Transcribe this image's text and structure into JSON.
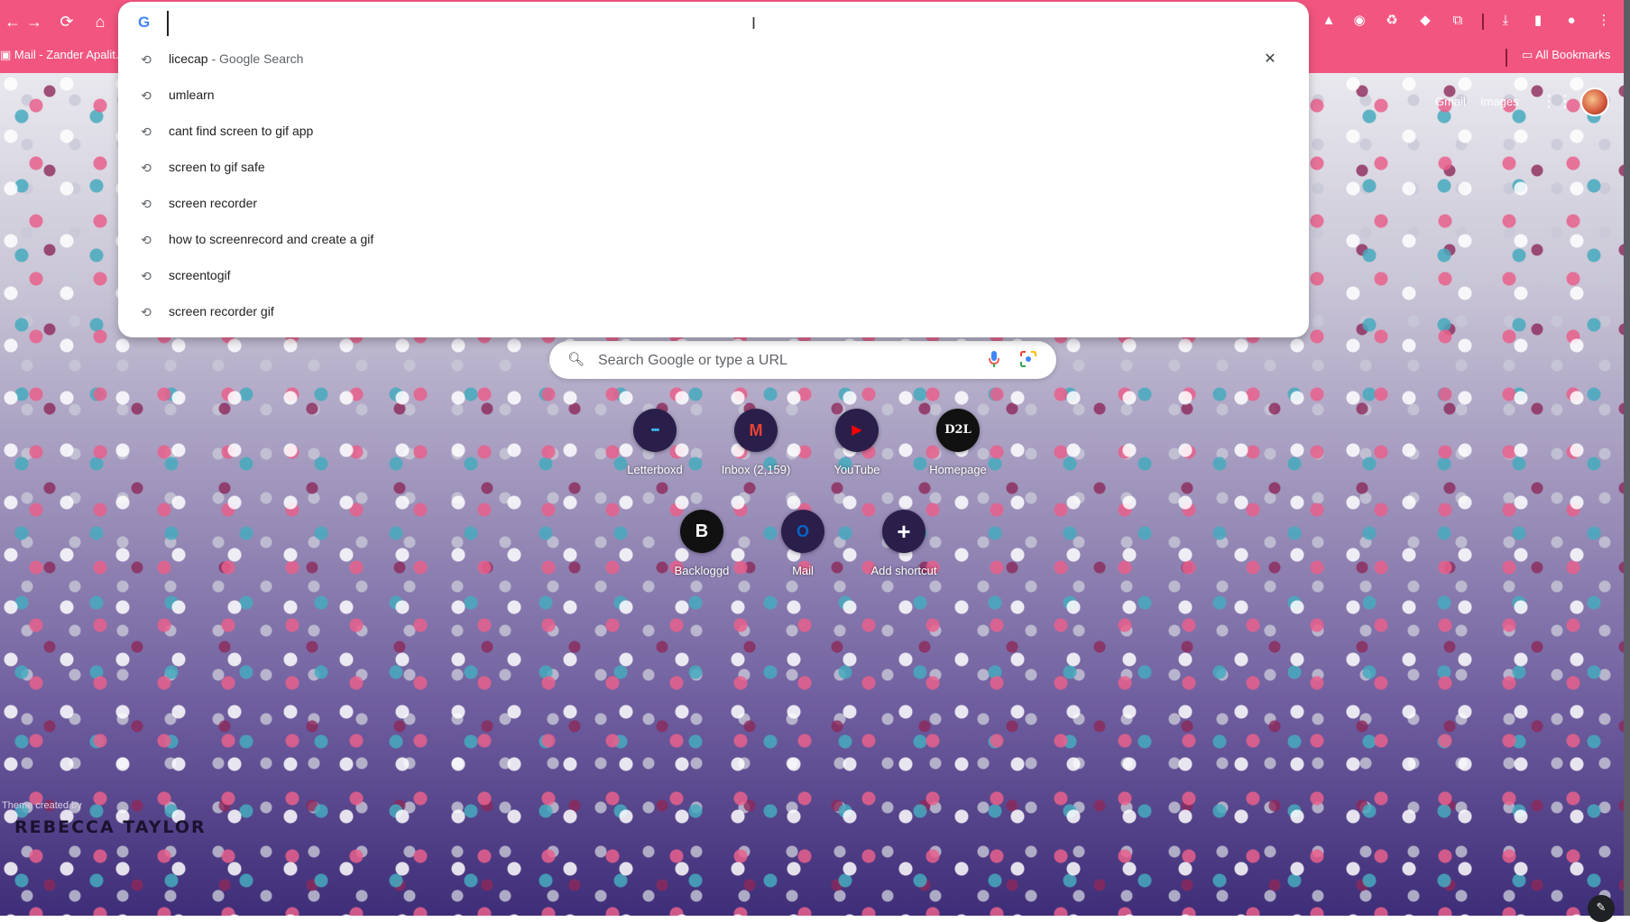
{
  "colors": {
    "chrome_accent": "#f25680",
    "omnibox_bg": "#ffffff",
    "tile_bg": "#2a1f4a"
  },
  "toolbar": {
    "back_icon": "back-arrow-icon",
    "forward_icon": "forward-arrow-icon",
    "reload_icon": "reload-icon",
    "home_icon": "home-icon"
  },
  "bookmarks": {
    "mail_tab": "Mail - Zander Apalit...",
    "all_bookmarks": "All Bookmarks"
  },
  "omnibox": {
    "value": "",
    "suggestions": [
      {
        "text": "licecap",
        "extra": " - Google Search"
      },
      {
        "text": "umlearn",
        "extra": ""
      },
      {
        "text": "cant find screen to gif app",
        "extra": ""
      },
      {
        "text": "screen to gif safe",
        "extra": ""
      },
      {
        "text": "screen recorder",
        "extra": ""
      },
      {
        "text": "how to screenrecord and create a gif",
        "extra": ""
      },
      {
        "text": "screentogif",
        "extra": ""
      },
      {
        "text": "screen recorder gif",
        "extra": ""
      }
    ]
  },
  "header": {
    "gmail": "Gmail",
    "images": "Images"
  },
  "realbox": {
    "placeholder": "Search Google or type a URL"
  },
  "shortcuts": [
    {
      "label": "Letterboxd",
      "glyph": "•••"
    },
    {
      "label": "Inbox (2,159)",
      "glyph": "M"
    },
    {
      "label": "YouTube",
      "glyph": "▶"
    },
    {
      "label": "Homepage",
      "glyph": "D2L"
    },
    {
      "label": "Backloggd",
      "glyph": "B"
    },
    {
      "label": "Mail",
      "glyph": "O"
    },
    {
      "label": "Add shortcut",
      "glyph": "+"
    }
  ],
  "theme": {
    "credit_small": "Theme created by",
    "credit_big": "REBECCA TAYLOR"
  }
}
